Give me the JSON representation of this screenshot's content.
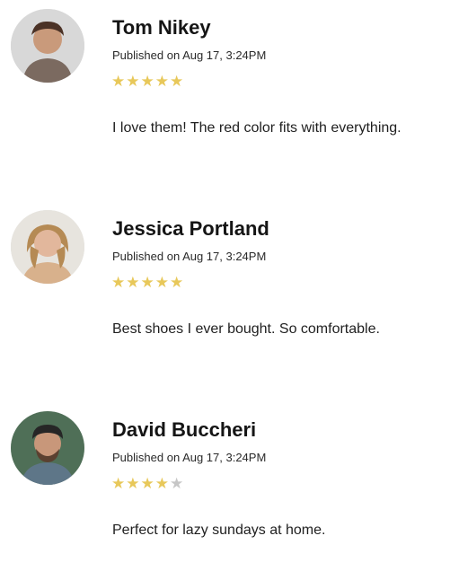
{
  "reviews": [
    {
      "name": "Tom Nikey",
      "published": "Published on Aug 17, 3:24PM",
      "rating": 5,
      "max_rating": 5,
      "comment": "I love them! The red color fits with everything."
    },
    {
      "name": "Jessica Portland",
      "published": "Published on Aug 17, 3:24PM",
      "rating": 5,
      "max_rating": 5,
      "comment": "Best shoes I ever bought. So comfortable."
    },
    {
      "name": "David Buccheri",
      "published": "Published on Aug 17, 3:24PM",
      "rating": 4,
      "max_rating": 5,
      "comment": "Perfect for lazy sundays at home."
    }
  ],
  "colors": {
    "star_filled": "#e8c85a",
    "star_empty": "#c6c6c6",
    "text": "#1f1f1f"
  },
  "icons": {
    "star": "star-icon"
  }
}
